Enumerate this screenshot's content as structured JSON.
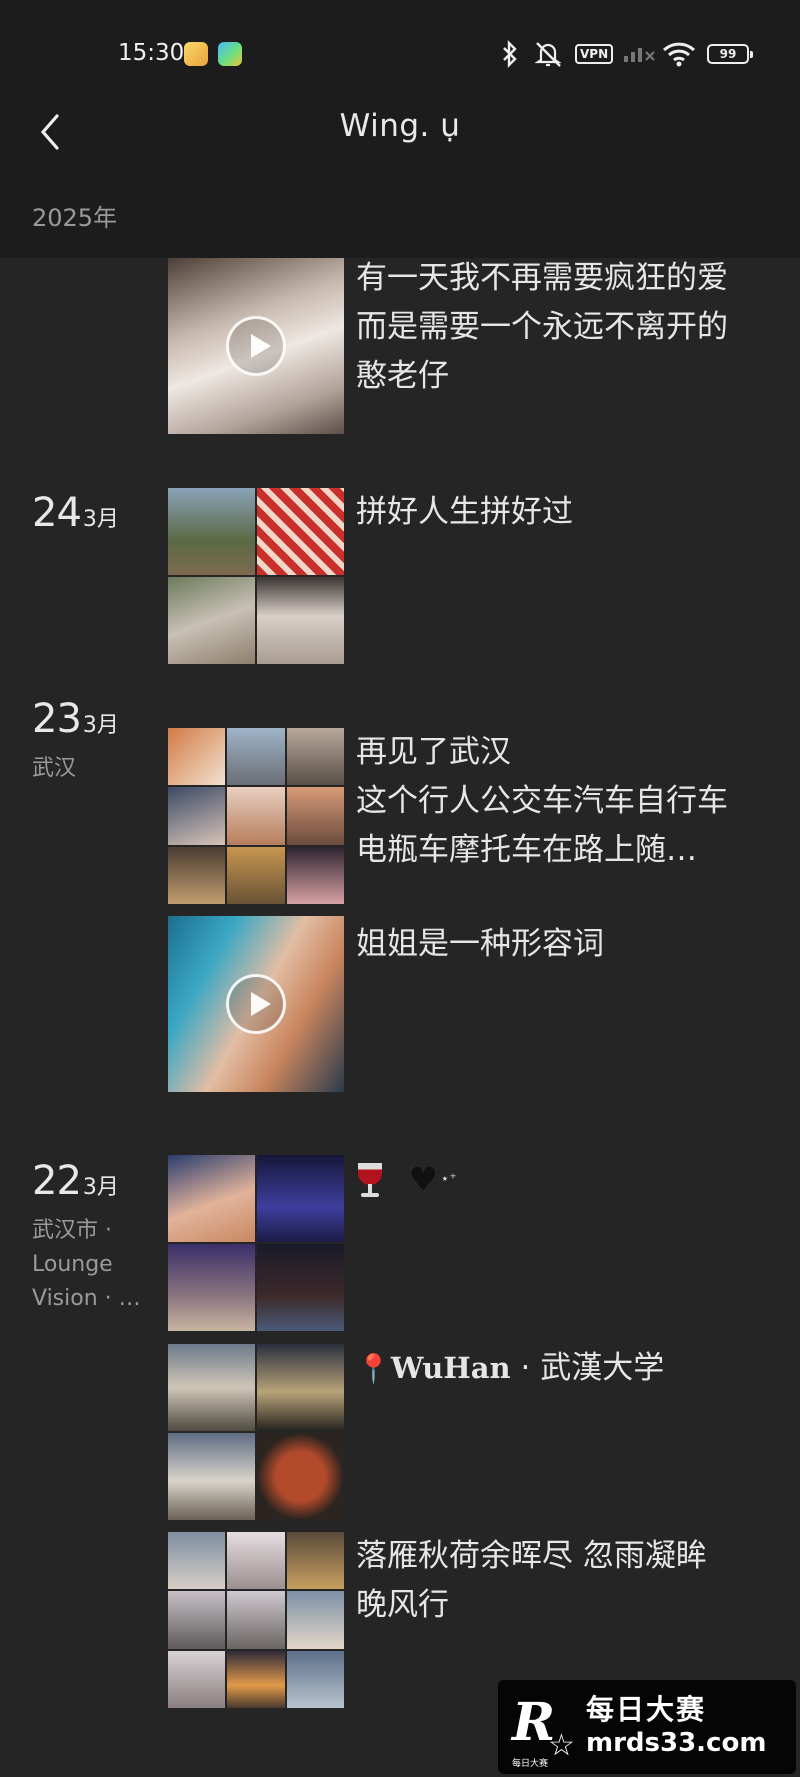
{
  "status_bar": {
    "time": "15:30",
    "vpn": "VPN",
    "battery": "99",
    "icons": [
      "bluetooth-icon",
      "mute-icon",
      "vpn-icon",
      "signal-icon",
      "wifi-icon",
      "battery-icon"
    ]
  },
  "header": {
    "title": "Wing. ụ",
    "year": "2025年"
  },
  "feed": {
    "entries": [
      {
        "text_lines": [
          "有一天我不再需要疯狂的爱",
          "而是需要一个永远不离开的",
          "憨老仔"
        ]
      },
      {
        "day": "24",
        "month": "3月",
        "location": "",
        "text": "拼好人生拼好过"
      },
      {
        "day": "23",
        "month": "3月",
        "location": "武汉",
        "post1_lines": [
          "再见了武汉",
          "这个行人公交车汽车自行车",
          "电瓶车摩托车在路上随…"
        ],
        "post2_text": "姐姐是一种形容词"
      },
      {
        "day": "22",
        "month": "3月",
        "location_lines": [
          "武汉市 ·",
          "Lounge",
          "Vision · …"
        ],
        "post1_sparkle": "⋆⁺",
        "post2_place": "WuHan",
        "post2_rest": " · 武漢大学",
        "post3_lines": [
          "落雁秋荷余晖尽  忽雨凝眸",
          "晚风行"
        ]
      }
    ]
  },
  "watermark": {
    "logo": "R",
    "cn": "每日大赛",
    "url": "mrds33.com",
    "sub": "每日大赛"
  },
  "colors": {
    "background": "#252525",
    "header": "#1c1c1c",
    "text": "#e6e6e6",
    "muted": "#9a9a9a",
    "pin": "#e53935"
  }
}
